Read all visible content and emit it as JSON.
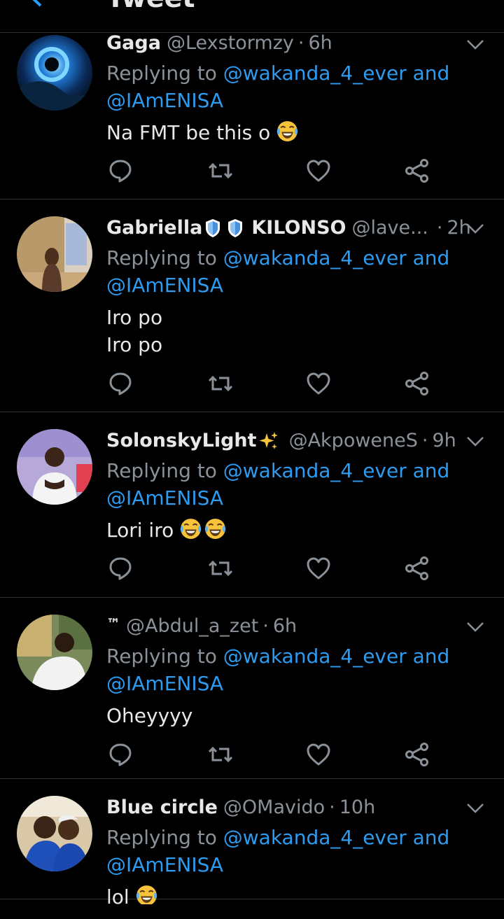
{
  "header": {
    "title": "Tweet",
    "back_icon": "back-arrow-icon"
  },
  "colors": {
    "background": "#000000",
    "link": "#2d9bf0",
    "muted": "#8a9199",
    "divider": "#2f3336"
  },
  "tweets": [
    {
      "name": "Gaga",
      "handle": "@Lexstormzy",
      "dot": "·",
      "time": "6h",
      "replying_prefix": "Replying to",
      "mention1": "@wakanda_4_ever",
      "and": "and",
      "mention2": "@IAmENISA",
      "text": "Na FMT be  this o",
      "emojis": [
        "tears-of-joy-emoji"
      ]
    },
    {
      "name": "Gabriella",
      "name_suffix": "KILONSO",
      "handle": "@lave...",
      "dot": "·",
      "time": "2h",
      "replying_prefix": "Replying to",
      "mention1": "@wakanda_4_ever",
      "and": "and",
      "mention2": "@IAmENISA",
      "text": "Iro po\nIro po",
      "emojis": []
    },
    {
      "name": "SolonskyLight",
      "handle": "@AkpoweneS",
      "dot": "·",
      "time": "9h",
      "replying_prefix": "Replying to",
      "mention1": "@wakanda_4_ever",
      "and": "and",
      "mention2": "@IAmENISA",
      "text": "Lori iro",
      "emojis": [
        "tears-of-joy-emoji",
        "tears-of-joy-emoji"
      ]
    },
    {
      "name": "™",
      "handle": "@Abdul_a_zet",
      "dot": "·",
      "time": "6h",
      "replying_prefix": "Replying to",
      "mention1": "@wakanda_4_ever",
      "and": "and",
      "mention2": "@IAmENISA",
      "text": "Oheyyyy",
      "emojis": []
    },
    {
      "name": "Blue circle",
      "handle": "@OMavido",
      "dot": "·",
      "time": "10h",
      "replying_prefix": "Replying to",
      "mention1": "@wakanda_4_ever",
      "and": "and",
      "mention2": "@IAmENISA",
      "text": "lol",
      "emojis": [
        "tears-of-joy-emoji"
      ]
    }
  ],
  "action_icons": [
    "reply-icon",
    "retweet-icon",
    "like-icon",
    "share-icon"
  ]
}
